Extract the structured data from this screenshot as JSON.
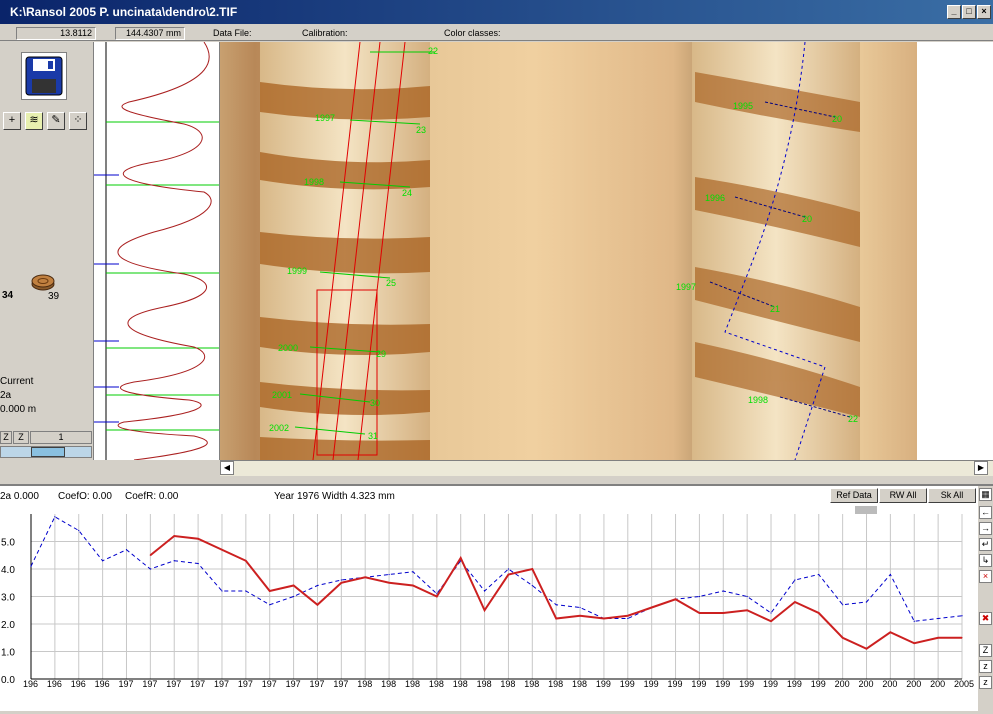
{
  "window": {
    "title": "K:\\Ransol 2005 P. uncinata\\dendro\\2.TIF",
    "min": "_",
    "max": "□",
    "close": "×"
  },
  "info": {
    "pos": "13.8112",
    "dist": "144.4307 mm",
    "data_file_label": "Data File:",
    "calibration_label": "Calibration:",
    "color_classes_label": "Color classes:"
  },
  "left": {
    "count_left": "34",
    "count_right": "39",
    "current_label": "Current",
    "series_id": "2a",
    "position": "0.000 m",
    "z_label": "Z",
    "page_num": "1",
    "tools": [
      "crosshair-icon",
      "tree-ring-icon",
      "pen-icon",
      "points-icon"
    ]
  },
  "image": {
    "left_core_years": [
      "1997",
      "1998",
      "1999",
      "2000",
      "2001",
      "2002"
    ],
    "left_core_values": [
      "22",
      "23",
      "24",
      "25",
      "29",
      "30",
      "31"
    ],
    "right_core_years": [
      "1995",
      "1996",
      "1997",
      "1998"
    ],
    "right_core_values": [
      "20",
      "20",
      "21",
      "22"
    ]
  },
  "graph_header": {
    "series_info": "2a 0.000",
    "coef_o": "CoefO: 0.00",
    "coef_r": "CoefR: 0.00",
    "year_info": "Year 1976  Width 4.323 mm",
    "ref_data_button": "Ref Data",
    "rw_all_button": "RW All",
    "sk_all_button": "Sk All"
  },
  "chart_data": {
    "type": "line",
    "title": "",
    "xlabel": "",
    "ylabel": "",
    "ylim": [
      0,
      6
    ],
    "yticks": [
      "0.0",
      "1.0",
      "2.0",
      "3.0",
      "4.0",
      "5.0"
    ],
    "x_ticks": [
      "196",
      "196",
      "196",
      "196",
      "197",
      "197",
      "197",
      "197",
      "197",
      "197",
      "197",
      "197",
      "197",
      "197",
      "198",
      "198",
      "198",
      "198",
      "198",
      "198",
      "198",
      "198",
      "198",
      "198",
      "199",
      "199",
      "199",
      "199",
      "199",
      "199",
      "199",
      "199",
      "199",
      "199",
      "200",
      "200",
      "200",
      "200",
      "200",
      "2005"
    ],
    "grid": true,
    "series": [
      {
        "style": "dashed-blue",
        "color": "#0000cc",
        "x": [
          1966,
          1967,
          1968,
          1969,
          1970,
          1971,
          1972,
          1973,
          1974,
          1975,
          1976,
          1977,
          1978,
          1979,
          1980,
          1981,
          1982,
          1983,
          1984,
          1985,
          1986,
          1987,
          1988,
          1989,
          1990,
          1991,
          1992,
          1993,
          1994,
          1995,
          1996,
          1997,
          1998,
          1999,
          2000,
          2001,
          2002,
          2003,
          2004,
          2005
        ],
        "values": [
          4.1,
          5.9,
          5.4,
          4.3,
          4.7,
          4.0,
          4.3,
          4.2,
          3.2,
          3.2,
          2.7,
          3.0,
          3.4,
          3.6,
          3.7,
          3.8,
          3.9,
          3.1,
          4.3,
          3.2,
          4.0,
          3.4,
          2.7,
          2.6,
          2.2,
          2.2,
          2.6,
          2.9,
          3.0,
          3.2,
          3.0,
          2.4,
          3.6,
          3.8,
          2.7,
          2.8,
          3.8,
          2.1,
          2.2,
          2.3
        ]
      },
      {
        "style": "solid-red",
        "color": "#cc2020",
        "x": [
          1971,
          1972,
          1973,
          1974,
          1975,
          1976,
          1977,
          1978,
          1979,
          1980,
          1981,
          1982,
          1983,
          1984,
          1985,
          1986,
          1987,
          1988,
          1989,
          1990,
          1991,
          1992,
          1993,
          1994,
          1995,
          1996,
          1997,
          1998,
          1999,
          2000,
          2001,
          2002,
          2003,
          2004,
          2005
        ],
        "values": [
          4.5,
          5.2,
          5.1,
          4.7,
          4.3,
          3.2,
          3.4,
          2.7,
          3.5,
          3.7,
          3.5,
          3.4,
          3.0,
          4.4,
          2.5,
          3.8,
          4.0,
          2.2,
          2.3,
          2.2,
          2.3,
          2.6,
          2.9,
          2.4,
          2.4,
          2.5,
          2.1,
          2.8,
          2.4,
          1.5,
          1.1,
          1.7,
          1.3,
          1.5,
          1.5
        ]
      }
    ]
  },
  "colors": {
    "title_bar": "#0a246a",
    "profile_line": "#aa2020",
    "marker_green": "#00cc00",
    "marker_blue": "#0000cc"
  }
}
